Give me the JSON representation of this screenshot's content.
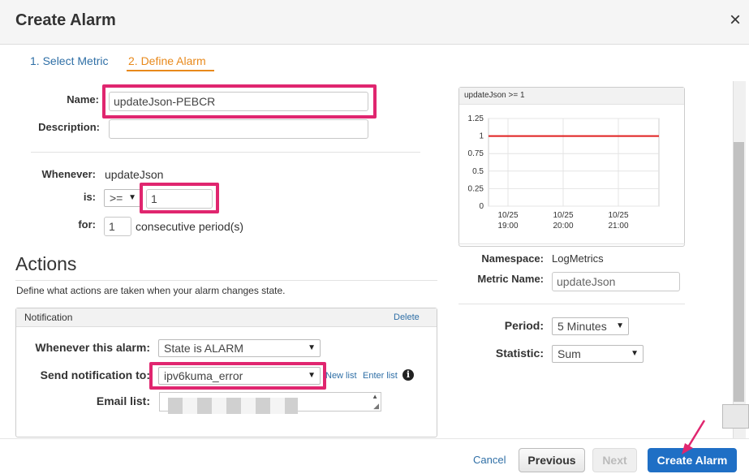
{
  "dialog": {
    "title": "Create Alarm",
    "close_glyph": "×"
  },
  "steps": {
    "step1": "1. Select Metric",
    "step2": "2. Define Alarm"
  },
  "form": {
    "name_label": "Name:",
    "name_value": "updateJson-PEBCR",
    "description_label": "Description:",
    "description_value": "",
    "whenever_label": "Whenever:",
    "whenever_value": "updateJson",
    "is_label": "is:",
    "operator": ">=",
    "threshold": "1",
    "for_label": "for:",
    "periods": "1",
    "periods_suffix": "consecutive period(s)"
  },
  "actions": {
    "heading": "Actions",
    "description": "Define what actions are taken when your alarm changes state.",
    "notification_title": "Notification",
    "delete_label": "Delete",
    "whenever_alarm_label": "Whenever this alarm:",
    "state_value": "State is ALARM",
    "send_label": "Send notification to:",
    "topic_value": "ipv6kuma_error",
    "new_list": "New list",
    "enter_list": "Enter list",
    "email_label": "Email list:"
  },
  "preview": {
    "chart_title": "updateJson >= 1",
    "namespace_label": "Namespace:",
    "namespace_value": "LogMetrics",
    "metric_label": "Metric Name:",
    "metric_value": "updateJson",
    "period_label": "Period:",
    "period_value": "5 Minutes",
    "statistic_label": "Statistic:",
    "statistic_value": "Sum"
  },
  "footer": {
    "cancel": "Cancel",
    "previous": "Previous",
    "next": "Next",
    "create": "Create Alarm"
  },
  "colors": {
    "accent_orange": "#e8891b",
    "link_blue": "#2f6fa6",
    "highlight": "#e0266f",
    "primary_button": "#1f6fc5",
    "threshold_line": "#e02020"
  },
  "chart_data": {
    "type": "line",
    "title": "updateJson >= 1",
    "x": [
      "10/25 19:00",
      "10/25 20:00",
      "10/25 21:00"
    ],
    "y_ticks": [
      0,
      0.25,
      0.5,
      0.75,
      1,
      1.25
    ],
    "ylim": [
      0,
      1.25
    ],
    "series": [
      {
        "values": [
          1,
          1,
          1
        ]
      }
    ],
    "grid": true
  }
}
